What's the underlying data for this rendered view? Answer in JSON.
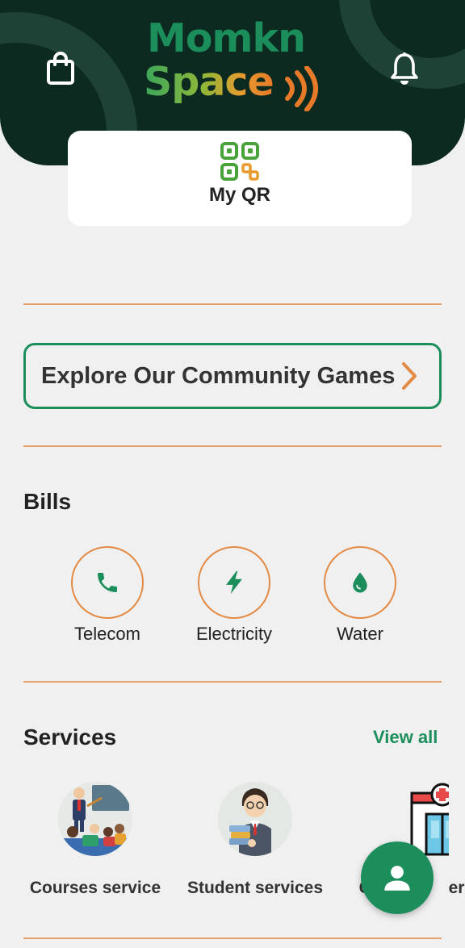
{
  "brand": {
    "logo_line1": "Momkn",
    "logo_line2": "Space"
  },
  "header": {
    "cart_icon": "shopping-bag-icon",
    "notifications_icon": "bell-icon"
  },
  "qr": {
    "label": "My QR",
    "icon": "qr-code-icon"
  },
  "games_banner": {
    "label": "Explore Our Community Games",
    "icon": "chevron-right-icon"
  },
  "bills": {
    "title": "Bills",
    "items": [
      {
        "label": "Telecom",
        "icon": "phone-icon"
      },
      {
        "label": "Electricity",
        "icon": "lightning-icon"
      },
      {
        "label": "Water",
        "icon": "water-drop-icon"
      }
    ]
  },
  "services": {
    "title": "Services",
    "view_all": "View all",
    "items": [
      {
        "label": "Courses service",
        "icon": "classroom-illustration"
      },
      {
        "label": "Student services",
        "icon": "student-illustration"
      },
      {
        "label": "Cl",
        "label_end": "er",
        "icon": "hospital-illustration"
      }
    ]
  },
  "fab": {
    "icon": "user-icon"
  },
  "colors": {
    "header_bg": "#0d2a20",
    "primary_green": "#1b8e5c",
    "accent_orange": "#e38a45",
    "background": "#f0f0f0"
  }
}
